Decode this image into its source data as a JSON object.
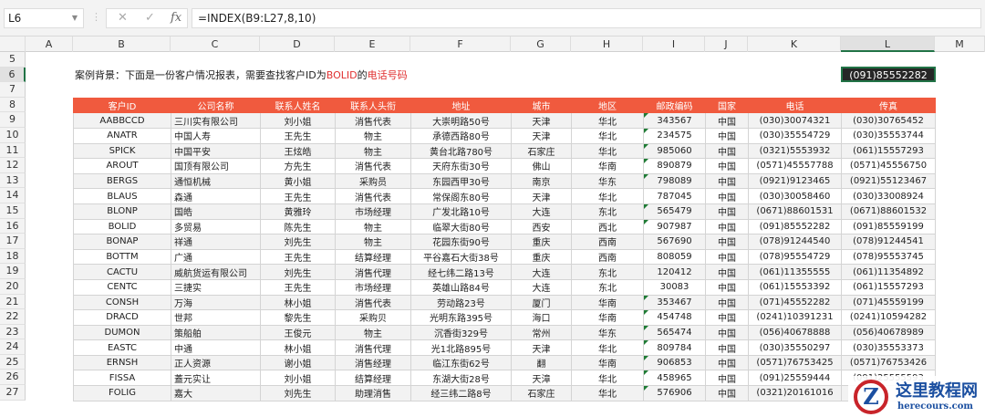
{
  "namebox": "L6",
  "formula": "=INDEX(B9:L27,8,10)",
  "icons": {
    "cancel": "✕",
    "confirm": "✓",
    "fx": "fx"
  },
  "columns": [
    "A",
    "B",
    "C",
    "D",
    "E",
    "F",
    "G",
    "H",
    "I",
    "J",
    "K",
    "L",
    "M"
  ],
  "rows": [
    "5",
    "6",
    "7",
    "8",
    "9",
    "10",
    "11",
    "12",
    "13",
    "14",
    "15",
    "16",
    "17",
    "18",
    "19",
    "20",
    "21",
    "22",
    "23",
    "24",
    "25",
    "26",
    "27"
  ],
  "note": {
    "part1": "案例背景：下面是一份客户情况报表，需要查找客户ID为",
    "highlight1": "BOLID",
    "part2": "的",
    "highlight2": "电话号码"
  },
  "result": "(091)85552282",
  "table": {
    "headers": [
      "客户ID",
      "公司名称",
      "联系人姓名",
      "联系人头衔",
      "地址",
      "城市",
      "地区",
      "邮政编码",
      "国家",
      "电话",
      "传真"
    ],
    "rows": [
      [
        "AABBCCD",
        "三川实有限公司",
        "刘小姐",
        "消售代表",
        "大崇明路50号",
        "天津",
        "华北",
        "343567",
        "中国",
        "(030)30074321",
        "(030)30765452"
      ],
      [
        "ANATR",
        "中国人寿",
        "王先生",
        "物主",
        "承德西路80号",
        "天津",
        "华北",
        "234575",
        "中国",
        "(030)35554729",
        "(030)35553744"
      ],
      [
        "SPICK",
        "中国平安",
        "王炫皓",
        "物主",
        "黄台北路780号",
        "石家庄",
        "华北",
        "985060",
        "中国",
        "(0321)5553932",
        "(061)15557293"
      ],
      [
        "AROUT",
        "国顶有限公司",
        "方先生",
        "消售代表",
        "天府东街30号",
        "佛山",
        "华南",
        "890879",
        "中国",
        "(0571)45557788",
        "(0571)45556750"
      ],
      [
        "BERGS",
        "通恒机械",
        "黄小姐",
        "采购员",
        "东园西甲30号",
        "南京",
        "华东",
        "798089",
        "中国",
        "(0921)9123465",
        "(0921)55123467"
      ],
      [
        "BLAUS",
        "森通",
        "王先生",
        "消售代表",
        "常保阁东80号",
        "天津",
        "华北",
        "787045",
        "中国",
        "(030)30058460",
        "(030)33008924"
      ],
      [
        "BLONP",
        "国皓",
        "黄雅玲",
        "市场经理",
        "广发北路10号",
        "大连",
        "东北",
        "565479",
        "中国",
        "(0671)88601531",
        "(0671)88601532"
      ],
      [
        "BOLID",
        "多贸易",
        "陈先生",
        "物主",
        "临翠大街80号",
        "西安",
        "西北",
        "907987",
        "中国",
        "(091)85552282",
        "(091)85559199"
      ],
      [
        "BONAP",
        "祥通",
        "刘先生",
        "物主",
        "花园东街90号",
        "重庆",
        "西南",
        "567690",
        "中国",
        "(078)91244540",
        "(078)91244541"
      ],
      [
        "BOTTM",
        "广通",
        "王先生",
        "结算经理",
        "平谷嘉石大街38号",
        "重庆",
        "西南",
        "808059",
        "中国",
        "(078)95554729",
        "(078)95553745"
      ],
      [
        "CACTU",
        "威航货运有限公司",
        "刘先生",
        "消售代理",
        "经七纬二路13号",
        "大连",
        "东北",
        "120412",
        "中国",
        "(061)11355555",
        "(061)11354892"
      ],
      [
        "CENTC",
        "三捷实",
        "王先生",
        "市场经理",
        "英雄山路84号",
        "大连",
        "东北",
        "30083",
        "中国",
        "(061)15553392",
        "(061)15557293"
      ],
      [
        "CONSH",
        "万海",
        "林小姐",
        "消售代表",
        "劳动路23号",
        "厦门",
        "华南",
        "353467",
        "中国",
        "(071)45552282",
        "(071)45559199"
      ],
      [
        "DRACD",
        "世邦",
        "黎先生",
        "采购贝",
        "光明东路395号",
        "海口",
        "华南",
        "454748",
        "中国",
        "(0241)10391231",
        "(0241)10594282"
      ],
      [
        "DUMON",
        "策船舶",
        "王俊元",
        "物主",
        "沉香街329号",
        "常州",
        "华东",
        "565474",
        "中国",
        "(056)40678888",
        "(056)40678989"
      ],
      [
        "EASTC",
        "中通",
        "林小姐",
        "消售代理",
        "光1北路895号",
        "天津",
        "华北",
        "809784",
        "中国",
        "(030)35550297",
        "(030)35553373"
      ],
      [
        "ERNSH",
        "正人资源",
        "谢小姐",
        "消售经理",
        "临江东街62号",
        "翻",
        "华南",
        "906853",
        "中国",
        "(0571)76753425",
        "(0571)76753426"
      ],
      [
        "FISSA",
        "蓋元实让",
        "刘小姐",
        "结算经理",
        "东湖大街28号",
        "天漳",
        "华北",
        "458965",
        "中国",
        "(091)25559444",
        "(091)25555593"
      ],
      [
        "FOLIG",
        "嘉大",
        "刘先生",
        "助理消售",
        "经三纬二路8号",
        "石家庄",
        "华北",
        "576906",
        "中国",
        "(0321)20161016",
        ""
      ]
    ],
    "tri_marked_rows": [
      0,
      1,
      2,
      3,
      4,
      6,
      7,
      12,
      13,
      14,
      15,
      16,
      17,
      18
    ]
  },
  "watermark": {
    "cn": "这里教程网",
    "url": "herecours.com",
    "logo": "Z"
  }
}
